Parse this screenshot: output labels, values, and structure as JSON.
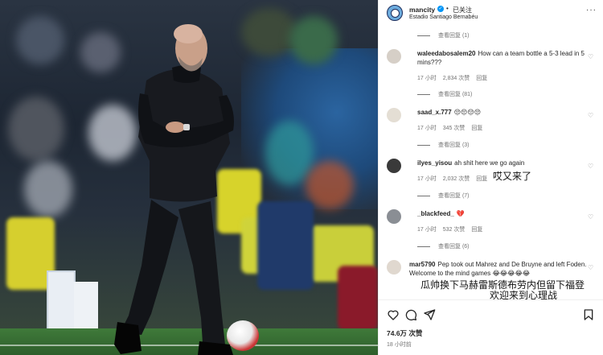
{
  "post": {
    "account": "mancity",
    "follow_label": "已关注",
    "location": "Estadio Santiago Bernabéu",
    "likes": "74.6万 次赞",
    "posted_time": "18 小时前"
  },
  "comments": [
    {
      "user": "",
      "text": "",
      "view_replies": "查看回复 (1)"
    },
    {
      "user": "waleedabosalem20",
      "text": "How can a team bottle a 5-3 lead in 5 mins???",
      "time": "17 小时",
      "likes": "2,834 次赞",
      "reply": "回复",
      "view_replies": "查看回复 (81)"
    },
    {
      "user": "saad_x.777",
      "text": "😔😔😔😔",
      "time": "17 小时",
      "likes": "345 次赞",
      "reply": "回复",
      "view_replies": "查看回复 (3)"
    },
    {
      "user": "ilyes_yisou",
      "text": "ah shit here we go again",
      "time": "17 小时",
      "likes": "2,032 次赞",
      "reply": "回复",
      "view_replies": "查看回复 (7)"
    },
    {
      "user": "_blackfeed_",
      "text": "💔",
      "time": "17 小时",
      "likes": "532 次赞",
      "reply": "回复",
      "view_replies": "查看回复 (6)"
    },
    {
      "user": "mar5790",
      "text": "Pep took out Mahrez and De Bruyne and left Foden. Welcome to the mind games 😂😂😂😂😂"
    }
  ],
  "overlays": {
    "ilyes_translation": "哎又来了",
    "mar_translation_1": "瓜帅换下马赫雷斯德布劳内但留下福登",
    "mar_translation_2": "欢迎来到心理战"
  },
  "icons": {
    "like": "heart-icon",
    "comment": "comment-icon",
    "share": "share-icon",
    "save": "bookmark-icon",
    "more": "more-icon"
  },
  "colors": {
    "verified": "#0095f6",
    "mancity_blue": "#6cabdd",
    "text": "#262626",
    "muted": "#737373"
  }
}
